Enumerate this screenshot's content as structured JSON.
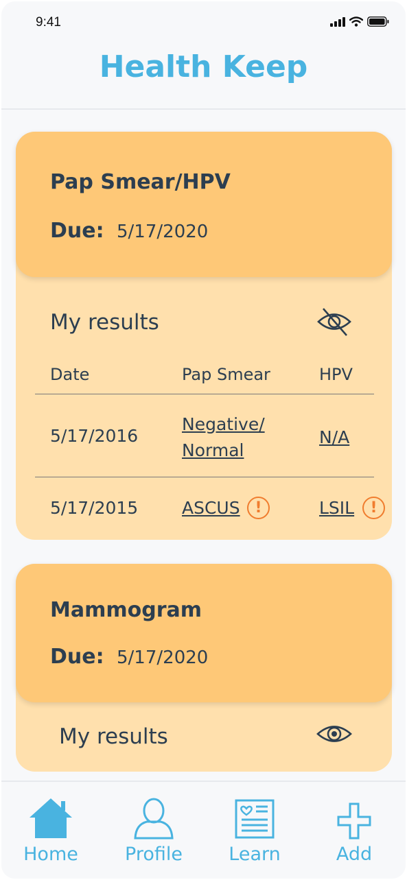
{
  "status": {
    "time": "9:41"
  },
  "app": {
    "title": "Health Keep"
  },
  "cards": [
    {
      "title": "Pap Smear/HPV",
      "due_label": "Due:",
      "due_date": "5/17/2020",
      "results_label": "My results",
      "results_visible": false,
      "eye_icon": "eye-slash-icon",
      "table": {
        "headers": [
          "Date",
          "Pap Smear",
          "HPV"
        ],
        "rows": [
          {
            "date": "5/17/2016",
            "pap_line1": "Negative/",
            "pap_line2": "Normal",
            "hpv": "N/A",
            "pap_warning": false,
            "hpv_warning": false
          },
          {
            "date": "5/17/2015",
            "pap_line1": "ASCUS",
            "pap_line2": "",
            "hpv": "LSIL",
            "pap_warning": true,
            "hpv_warning": true
          }
        ]
      },
      "warning_glyph": "!"
    },
    {
      "title": "Mammogram",
      "due_label": "Due:",
      "due_date": "5/17/2020",
      "results_label": "My results",
      "results_visible": true,
      "eye_icon": "eye-icon"
    }
  ],
  "nav": [
    {
      "label": "Home",
      "icon": "home-icon",
      "active": true
    },
    {
      "label": "Profile",
      "icon": "profile-icon"
    },
    {
      "label": "Learn",
      "icon": "learn-icon"
    },
    {
      "label": "Add",
      "icon": "plus-icon"
    }
  ],
  "colors": {
    "brand": "#49b3e0",
    "card_header": "#fec877",
    "card_body": "#ffe0ad",
    "warning": "#f07c2e",
    "text": "#2c3e50"
  }
}
